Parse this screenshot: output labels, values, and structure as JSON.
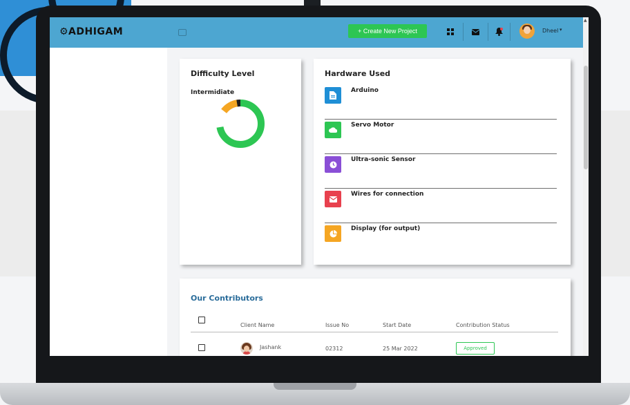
{
  "navbar": {
    "brand": "⚙ADHIGAM",
    "create_button": "+ Create New Project",
    "username": "Dheel",
    "icons": [
      "grid-icon",
      "mail-icon",
      "bell-icon",
      "chevron-down-icon"
    ]
  },
  "difficulty": {
    "title": "Difficulty Level",
    "level": "Intermidiate",
    "donut": [
      {
        "label": "green",
        "value": 0.75,
        "color": "#2dc653"
      },
      {
        "label": "orange",
        "value": 0.13,
        "color": "#f5a623"
      },
      {
        "label": "black",
        "value": 0.12,
        "color": "#1e1e1e"
      }
    ]
  },
  "hardware": {
    "title": "Hardware Used",
    "items": [
      {
        "label": "Arduino",
        "color": "#1f8fd6",
        "icon": "document-icon"
      },
      {
        "label": "Servo Motor",
        "color": "#2dc653",
        "icon": "cloud-icon"
      },
      {
        "label": "Ultra-sonic Sensor",
        "color": "#8a4fd6",
        "icon": "clock-icon"
      },
      {
        "label": "Wires for connection",
        "color": "#e8414e",
        "icon": "mail-icon"
      },
      {
        "label": "Display (for output)",
        "color": "#f5a623",
        "icon": "pie-chart-icon"
      }
    ]
  },
  "contributors": {
    "title": "Our Contributors",
    "columns": [
      "Client Name",
      "Issue No",
      "Start Date",
      "Contribution Status"
    ],
    "rows": [
      {
        "name": "Jashank",
        "issue": "02312",
        "date": "25 Mar 2022",
        "status": "Approved"
      }
    ]
  }
}
